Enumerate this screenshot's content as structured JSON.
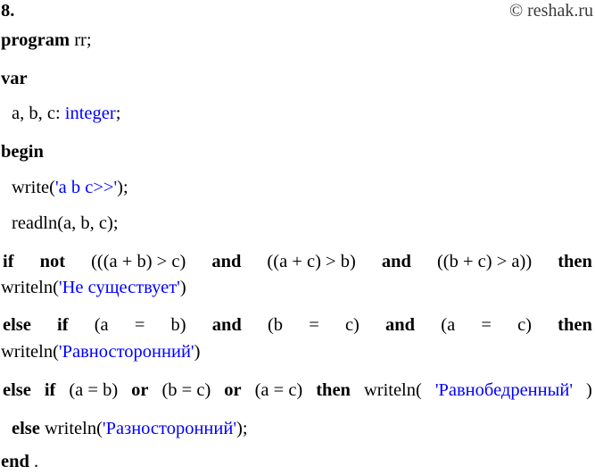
{
  "header": {
    "number": "8.",
    "watermark": "© reshak.ru"
  },
  "code": {
    "language": "pascal",
    "text_color": "#000000",
    "string_color": "#0000ff",
    "lines": [
      {
        "id": "program",
        "indent": 0,
        "parts": [
          {
            "t": "program",
            "style": "bold"
          },
          {
            "t": " rr;",
            "style": "plain"
          }
        ]
      },
      {
        "id": "var",
        "indent": 0,
        "parts": [
          {
            "t": "var",
            "style": "bold"
          }
        ]
      },
      {
        "id": "vardecl",
        "indent": 1,
        "parts": [
          {
            "t": "a, b, c: ",
            "style": "plain"
          },
          {
            "t": "integer",
            "style": "blue"
          },
          {
            "t": ";",
            "style": "plain"
          }
        ]
      },
      {
        "id": "begin",
        "indent": 0,
        "parts": [
          {
            "t": "begin",
            "style": "bold"
          }
        ]
      },
      {
        "id": "write",
        "indent": 1,
        "parts": [
          {
            "t": "write(",
            "style": "plain"
          },
          {
            "t": "'a b c>>'",
            "style": "blue"
          },
          {
            "t": ");",
            "style": "plain"
          }
        ]
      },
      {
        "id": "readln",
        "indent": 1,
        "parts": [
          {
            "t": "readln(a, b, c);",
            "style": "plain"
          }
        ]
      },
      {
        "id": "if-not",
        "indent": 1,
        "justify": true,
        "parts": [
          {
            "t": "if",
            "style": "bold"
          },
          {
            "t": "not",
            "style": "bold"
          },
          {
            "t": "(((a + b) > c)",
            "style": "plain"
          },
          {
            "t": "and",
            "style": "bold"
          },
          {
            "t": "((a + c) > b)",
            "style": "plain"
          },
          {
            "t": "and",
            "style": "bold"
          },
          {
            "t": "((b + c) > a))",
            "style": "plain"
          },
          {
            "t": "then",
            "style": "bold"
          }
        ]
      },
      {
        "id": "writeln-ne",
        "indent": 0,
        "parts": [
          {
            "t": "writeln(",
            "style": "plain"
          },
          {
            "t": "'Не существует'",
            "style": "blue"
          },
          {
            "t": ")",
            "style": "plain"
          }
        ]
      },
      {
        "id": "else-if-and",
        "indent": 1,
        "justify": true,
        "parts": [
          {
            "t": "else",
            "style": "bold"
          },
          {
            "t": "if",
            "style": "bold"
          },
          {
            "t": "(a",
            "style": "plain"
          },
          {
            "t": "=",
            "style": "plain"
          },
          {
            "t": "b)",
            "style": "plain"
          },
          {
            "t": "and",
            "style": "bold"
          },
          {
            "t": "(b",
            "style": "plain"
          },
          {
            "t": "=",
            "style": "plain"
          },
          {
            "t": "c)",
            "style": "plain"
          },
          {
            "t": "and",
            "style": "bold"
          },
          {
            "t": "(a",
            "style": "plain"
          },
          {
            "t": "=",
            "style": "plain"
          },
          {
            "t": "c)",
            "style": "plain"
          },
          {
            "t": "then",
            "style": "bold"
          }
        ]
      },
      {
        "id": "writeln-ravnostoronniy",
        "indent": 0,
        "parts": [
          {
            "t": "writeln(",
            "style": "plain"
          },
          {
            "t": "'Равносторонний'",
            "style": "blue"
          },
          {
            "t": ")",
            "style": "plain"
          }
        ]
      },
      {
        "id": "else-if-or",
        "indent": 1,
        "justify": true,
        "parts": [
          {
            "t": "else",
            "style": "bold"
          },
          {
            "t": "if",
            "style": "bold"
          },
          {
            "t": "(a = b)",
            "style": "plain"
          },
          {
            "t": "or",
            "style": "bold"
          },
          {
            "t": "(b = c)",
            "style": "plain"
          },
          {
            "t": "or",
            "style": "bold"
          },
          {
            "t": "(a = c)",
            "style": "plain"
          },
          {
            "t": "then",
            "style": "bold"
          },
          {
            "t": "writeln(",
            "style": "plain"
          },
          {
            "t": "'Равнобедренный'",
            "style": "blue"
          },
          {
            "t": ")",
            "style": "plain"
          }
        ]
      },
      {
        "id": "else-last",
        "indent": 1,
        "parts": [
          {
            "t": "else",
            "style": "bold"
          },
          {
            "t": " writeln(",
            "style": "plain"
          },
          {
            "t": "'Разносторонний'",
            "style": "blue"
          },
          {
            "t": ");",
            "style": "plain"
          }
        ]
      },
      {
        "id": "end",
        "indent": 0,
        "parts": [
          {
            "t": "end",
            "style": "bold"
          },
          {
            "t": ".",
            "style": "plain"
          }
        ]
      }
    ]
  }
}
